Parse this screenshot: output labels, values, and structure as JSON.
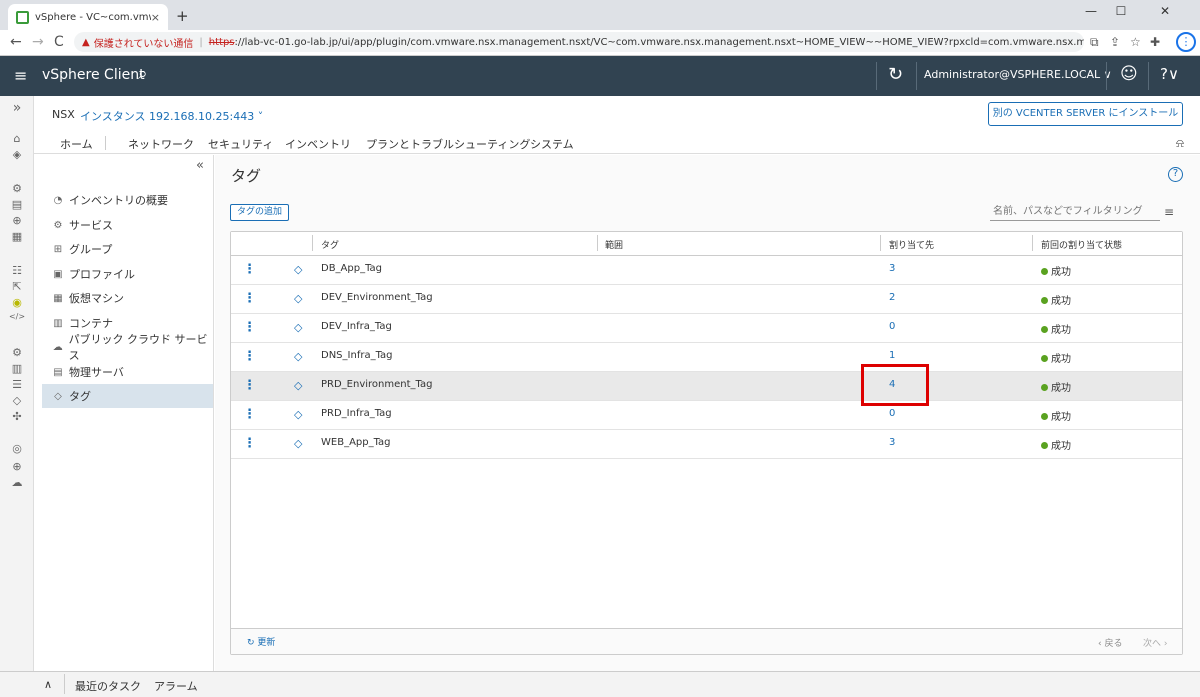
{
  "browser": {
    "tab_title": "vSphere - VC~com.vmware.nsx.m",
    "close_glyph": "×",
    "new_tab_glyph": "+",
    "win_min": "—",
    "win_max": "☐",
    "win_close": "✕",
    "back": "←",
    "forward": "→",
    "reload": "C",
    "warning_glyph": "▲",
    "insecure_label": "保護されていない通信",
    "url_scheme": "https",
    "url_rest": "://lab-vc-01.go-lab.jp/ui/app/plugin/com.vmware.nsx.management.nsxt/VC~com.vmware.nsx.management.nsxt~HOME_VIEW~~HOME_VIEW?rpxcld=com.vmware.nsx.management.nsxt:3.2.0.1:-5535...",
    "menu_glyph": "⋮"
  },
  "vsphere": {
    "menu_icon": "≡",
    "brand": "vSphere Client",
    "search_icon": "⌕",
    "refresh_icon": "↻",
    "user": "Administrator@VSPHERE.LOCAL ∨",
    "feedback_icon": "☺",
    "help_icon": "?∨"
  },
  "rail": {
    "expand": "»",
    "icons": [
      "⌂",
      "◈",
      "⚙",
      "▤",
      "⊕",
      "▦",
      "☷",
      "⇱",
      "◉",
      "</>",
      "⚙",
      "▥",
      "☰",
      "◇",
      "✣",
      "◎",
      "⊕",
      "☁"
    ]
  },
  "nsx": {
    "label": "NSX",
    "instance": "インスタンス 192.168.10.25:443 ˅",
    "install_button": "別の VCENTER SERVER にインストール"
  },
  "nav_tabs": [
    "ホーム",
    "ネットワーク",
    "セキュリティ",
    "インベントリ",
    "プランとトラブルシューティング",
    "システム"
  ],
  "bell": "🔔",
  "sidebar": {
    "collapse": "«",
    "items": [
      {
        "label": "インベントリの概要",
        "icon": "◔"
      },
      {
        "label": "サービス",
        "icon": "⚙"
      },
      {
        "label": "グループ",
        "icon": "⊞"
      },
      {
        "label": "プロファイル",
        "icon": "▣"
      },
      {
        "label": "仮想マシン",
        "icon": "▦"
      },
      {
        "label": "コンテナ",
        "icon": "▥"
      },
      {
        "label": "パブリック クラウド サービス",
        "icon": "☁"
      },
      {
        "label": "物理サーバ",
        "icon": "▤"
      },
      {
        "label": "タグ",
        "icon": "◇"
      }
    ]
  },
  "page": {
    "title": "タグ",
    "help": "?",
    "add_button": "タグの追加",
    "filter_placeholder": "名前、パスなどでフィルタリング",
    "filter_icon": "≡"
  },
  "grid": {
    "columns": [
      "タグ",
      "範囲",
      "割り当て先",
      "前回の割り当て状態"
    ],
    "kebab": "⋮",
    "tag_icon": "◇",
    "rows": [
      {
        "tag": "DB_App_Tag",
        "scope": "",
        "assigned": "3",
        "status": "成功"
      },
      {
        "tag": "DEV_Environment_Tag",
        "scope": "",
        "assigned": "2",
        "status": "成功"
      },
      {
        "tag": "DEV_Infra_Tag",
        "scope": "",
        "assigned": "0",
        "status": "成功"
      },
      {
        "tag": "DNS_Infra_Tag",
        "scope": "",
        "assigned": "1",
        "status": "成功"
      },
      {
        "tag": "PRD_Environment_Tag",
        "scope": "",
        "assigned": "4",
        "status": "成功"
      },
      {
        "tag": "PRD_Infra_Tag",
        "scope": "",
        "assigned": "0",
        "status": "成功"
      },
      {
        "tag": "WEB_App_Tag",
        "scope": "",
        "assigned": "3",
        "status": "成功"
      }
    ],
    "refresh": "↻ 更新",
    "prev": "‹ 戻る",
    "next": "次へ ›"
  },
  "bottom": {
    "toggle": "∧",
    "recent_tasks": "最近のタスク",
    "alarms": "アラーム"
  },
  "colors": {
    "accent": "#1a6eb5",
    "header": "#314351",
    "success": "#5aa220",
    "highlight": "#dd0000"
  }
}
